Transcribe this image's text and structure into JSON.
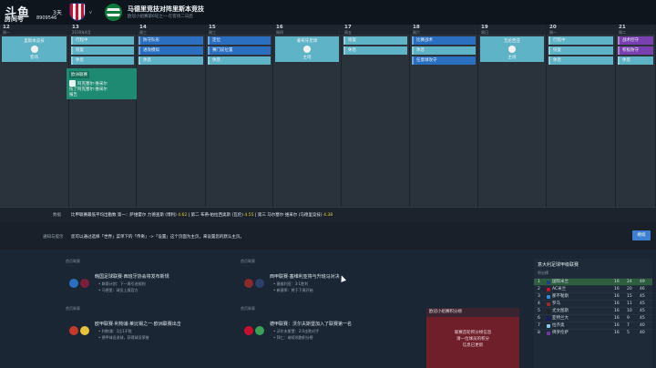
{
  "watermark": {
    "logo": "斗鱼",
    "room_label": "房间号",
    "room_id": "8909546"
  },
  "header": {
    "days": "3天",
    "vs": "v",
    "title": "马德里竞技对阵里斯本竞技",
    "subtitle": "欧冠小组赛第6轮之一·在客场二日后"
  },
  "calendar": {
    "days": [
      {
        "num": "12",
        "wd": "周一",
        "events": [],
        "match": {
          "label": "里斯本竞技",
          "sub": "客场"
        }
      },
      {
        "num": "13",
        "wd": "2030年4月",
        "events": [
          {
            "t": "行程中",
            "c": "teal"
          },
          {
            "t": "恢复",
            "c": "teal"
          },
          {
            "t": "休息",
            "c": "teal"
          }
        ]
      },
      {
        "num": "14",
        "wd": "周三",
        "events": [
          {
            "t": "防守队形",
            "c": "blue"
          },
          {
            "t": "进攻模拟",
            "c": "blue"
          },
          {
            "t": "休息",
            "c": "teal"
          }
        ]
      },
      {
        "num": "15",
        "wd": "周三",
        "events": [
          {
            "t": "定位",
            "c": "blue"
          },
          {
            "t": "赛门前位置",
            "c": "blue"
          },
          {
            "t": "休息",
            "c": "teal"
          }
        ]
      },
      {
        "num": "16",
        "wd": "周四",
        "events": [],
        "match": {
          "label": "葡萄牙足球",
          "sub": "主场"
        }
      },
      {
        "num": "17",
        "wd": "周五",
        "events": [
          {
            "t": "恢复",
            "c": "teal"
          },
          {
            "t": "休息",
            "c": "teal"
          }
        ]
      },
      {
        "num": "18",
        "wd": "周六",
        "events": [
          {
            "t": "比赛战术",
            "c": "blue"
          },
          {
            "t": "休息",
            "c": "teal"
          },
          {
            "t": "任意球攻守",
            "c": "blue"
          }
        ]
      },
      {
        "num": "19",
        "wd": "周日",
        "events": [],
        "match": {
          "label": "瓦伦西亚",
          "sub": "主场"
        }
      },
      {
        "num": "20",
        "wd": "周一",
        "events": [
          {
            "t": "行程中",
            "c": "teal"
          },
          {
            "t": "恢复",
            "c": "teal"
          },
          {
            "t": "休息",
            "c": "teal"
          }
        ]
      },
      {
        "num": "21",
        "wd": "周二",
        "events": [
          {
            "t": "战术控守",
            "c": "purple"
          },
          {
            "t": "积极防守",
            "c": "purple"
          },
          {
            "t": "休息",
            "c": "teal"
          }
        ]
      }
    ],
    "card": {
      "tag": "欧洲联赛",
      "text1": "阿克塞尔·维采尔",
      "text2": "伤了阿克塞尔·维采尔",
      "text3": "报告"
    }
  },
  "strip1": {
    "label": "数据",
    "text": "比甲联赛最低平均出勤数 第一：萨维霍尔 力德查斯 (博利)",
    "v1": "4.62",
    "text2": "第二 布蒂·帕拉西奥斯 (瓦伦)",
    "v2": "4.55",
    "text3": "第三 马尔塞尔·维采尔 (马德里竞技)",
    "v3": "4.38"
  },
  "strip2": {
    "label": "通知与提示",
    "text": "您可以通过选择「世界」菜单下的「传奇」->「设置」这个页面为主页，来设置您的默认主页。",
    "button": "继续"
  },
  "news": [
    {
      "cat": "首页联赛",
      "hl": "韩国足球联赛·西班牙协会将发布新规",
      "b1": "• 联赛计划：下一周引进规则",
      "b2": "• 马德里：球员上报官方",
      "c1": "#2a6fc0",
      "c2": "#7a1f3a"
    },
    {
      "cat": "首页联赛",
      "hl": "西甲联赛·塞维利亚将与升班马对决",
      "b1": "• 塞维利亚：3:1胜利",
      "b2": "• 新赛季：将于下周开始",
      "c1": "#8a2a2a",
      "c2": "#2a3f6a"
    },
    {
      "cat": "首页联赛",
      "hl": "欧甲联赛·利物浦·莱比锡之一·欧洲联赛出击",
      "b1": "• 利物浦：1比1不败",
      "b2": "• 德甲球员进球，获得球员荣誉",
      "c1": "#c43a2a",
      "c2": "#e6c23a"
    },
    {
      "cat": "首页联赛",
      "hl": "德甲联赛：沃尔夫斯堡加入了联赛第一名",
      "b1": "• 沃尔夫斯堡：2:0击败对手",
      "b2": "• 拜仁：继续领跑积分榜",
      "c1": "#c8102e",
      "c2": "#3aa05a"
    }
  ],
  "popup": {
    "title": "欧冠小组赛积分榜",
    "body1": "联赛首轮积分榜信息",
    "body2": "请一位球员的积分",
    "body3": "信息已更新"
  },
  "league": {
    "title": "意大利足球甲级联赛",
    "subtitle": "积分榜",
    "rows": [
      {
        "pos": "1",
        "name": "国际米兰",
        "p": "16",
        "gd": "24",
        "pt": "49",
        "c": "#1a3f8a",
        "hl": true
      },
      {
        "pos": "2",
        "name": "AC米兰",
        "p": "16",
        "gd": "20",
        "pt": "46",
        "c": "#c8102e"
      },
      {
        "pos": "3",
        "name": "那不勒斯",
        "p": "16",
        "gd": "15",
        "pt": "45",
        "c": "#3a8ad0"
      },
      {
        "pos": "4",
        "name": "罗马",
        "p": "16",
        "gd": "11",
        "pt": "45",
        "c": "#9a2a2a"
      },
      {
        "pos": "5",
        "name": "尤文图斯",
        "p": "16",
        "gd": "10",
        "pt": "45",
        "c": "#222222"
      },
      {
        "pos": "6",
        "name": "亚特兰大",
        "p": "16",
        "gd": "9",
        "pt": "45",
        "c": "#1a1a6a"
      },
      {
        "pos": "7",
        "name": "拉齐奥",
        "p": "16",
        "gd": "7",
        "pt": "40",
        "c": "#8ac8e8"
      },
      {
        "pos": "8",
        "name": "佛罗伦萨",
        "p": "16",
        "gd": "5",
        "pt": "40",
        "c": "#6a3aa0"
      }
    ]
  }
}
